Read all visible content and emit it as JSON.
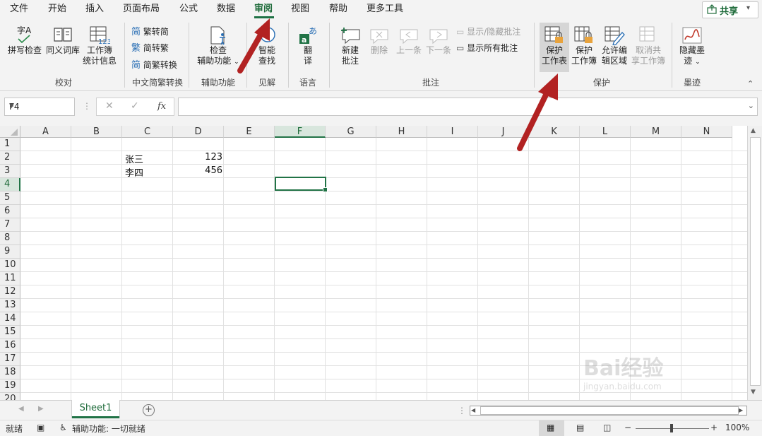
{
  "menu": {
    "items": [
      {
        "label": "文件"
      },
      {
        "label": "开始"
      },
      {
        "label": "插入"
      },
      {
        "label": "页面布局"
      },
      {
        "label": "公式"
      },
      {
        "label": "数据"
      },
      {
        "label": "审阅"
      },
      {
        "label": "视图"
      },
      {
        "label": "帮助"
      },
      {
        "label": "更多工具"
      }
    ],
    "share_label": "共享"
  },
  "ribbon": {
    "proofing": {
      "spell_label": "拼写检查",
      "spell_icon_text": "字A",
      "thesaurus_label": "同义词库",
      "stats_label_1": "工作簿",
      "stats_label_2": "统计信息",
      "stats_icon_text": "123",
      "group_label": "校对"
    },
    "chinese": {
      "to_simplified": "繁转简",
      "to_traditional": "简转繁",
      "convert": "简繁转换",
      "group_label": "中文简繁转换"
    },
    "accessibility": {
      "label_1": "检查",
      "label_2": "辅助功能",
      "group_label": "辅助功能"
    },
    "insights": {
      "label_1": "智能",
      "label_2": "查找",
      "group_label": "见解"
    },
    "language": {
      "label_1": "翻",
      "label_2": "译",
      "group_label": "语言"
    },
    "comments": {
      "new_1": "新建",
      "new_2": "批注",
      "delete": "删除",
      "prev": "上一条",
      "next": "下一条",
      "show_hide": "显示/隐藏批注",
      "show_all": "显示所有批注",
      "group_label": "批注"
    },
    "protect": {
      "sheet_1": "保护",
      "sheet_2": "工作表",
      "book_1": "保护",
      "book_2": "工作簿",
      "ranges_1": "允许编",
      "ranges_2": "辑区域",
      "unshare_1": "取消共",
      "unshare_2": "享工作簿",
      "group_label": "保护"
    },
    "ink": {
      "label_1": "隐藏墨",
      "label_2": "迹",
      "group_label": "墨迹"
    }
  },
  "formula_bar": {
    "name_box": "F4",
    "fx": "fx",
    "value": ""
  },
  "sheet": {
    "columns": [
      "A",
      "B",
      "C",
      "D",
      "E",
      "F",
      "G",
      "H",
      "I",
      "J",
      "K",
      "L",
      "M",
      "N"
    ],
    "rows": [
      "1",
      "2",
      "3",
      "4",
      "5",
      "6",
      "7",
      "8",
      "9",
      "10",
      "11",
      "12",
      "13",
      "14",
      "15",
      "16",
      "17",
      "18",
      "19",
      "20"
    ],
    "selected_cell": "F4",
    "cells": {
      "C2": "张三",
      "D2": "123",
      "C3": "李四",
      "D3": "456"
    },
    "tab_name": "Sheet1"
  },
  "status": {
    "ready": "就绪",
    "accessibility": "辅助功能: 一切就绪",
    "zoom": "100%"
  },
  "watermark": {
    "line1": "Bai经验",
    "line2": "jingyan.baidu.com"
  },
  "colors": {
    "accent": "#217346",
    "arrow": "#b22222"
  }
}
